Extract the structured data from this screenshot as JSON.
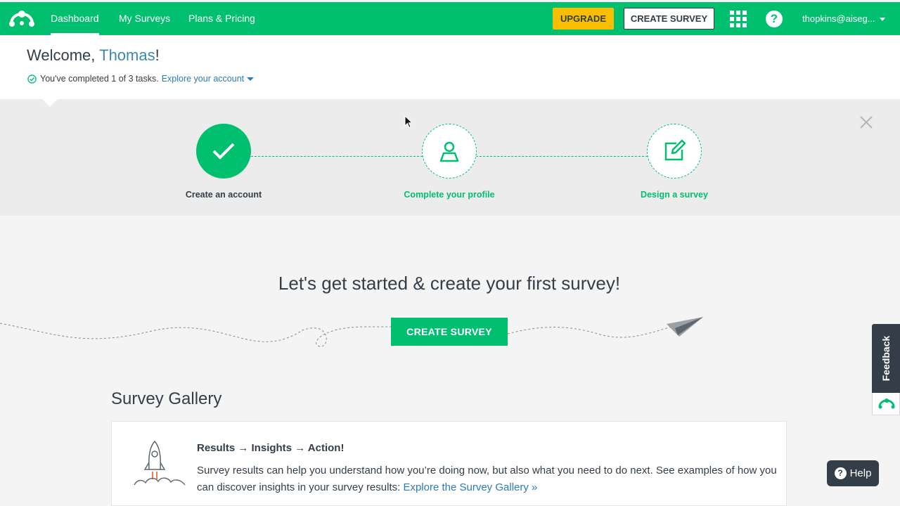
{
  "nav": {
    "links": [
      "Dashboard",
      "My Surveys",
      "Plans & Pricing"
    ],
    "active": "Dashboard",
    "upgrade_label": "UPGRADE",
    "create_survey_label": "CREATE SURVEY",
    "apps_icon": "grid-icon",
    "help_icon": "question-icon",
    "help_glyph": "?",
    "user": "thopkins@aiseg..."
  },
  "welcome": {
    "greeting": "Welcome, ",
    "name": "Thomas",
    "punct": "!",
    "tasks_text": "You've completed 1 of 3 tasks.",
    "explore_label": "Explore your account"
  },
  "steps": [
    {
      "label": "Create an account",
      "status": "done",
      "icon": "check-icon"
    },
    {
      "label": "Complete your profile",
      "status": "todo",
      "icon": "user-icon"
    },
    {
      "label": "Design a survey",
      "status": "todo",
      "icon": "edit-icon"
    }
  ],
  "getting_started": {
    "title": "Let's get started & create your first survey!",
    "button_label": "CREATE SURVEY"
  },
  "gallery": {
    "title": "Survey Gallery",
    "card_heading": "Results → Insights → Action!",
    "card_text": "Survey results can help you understand how you’re doing now, but also what you need to do next. See examples of how you can discover insights in your survey results: ",
    "card_link": "Explore the Survey Gallery »"
  },
  "feedback": {
    "label": "Feedback"
  },
  "help": {
    "label": "Help",
    "glyph": "?"
  },
  "colors": {
    "brand_green": "#00bf6f",
    "upgrade_yellow": "#f9be00",
    "dark": "#333e48",
    "link_blue": "#2b7bb9"
  }
}
